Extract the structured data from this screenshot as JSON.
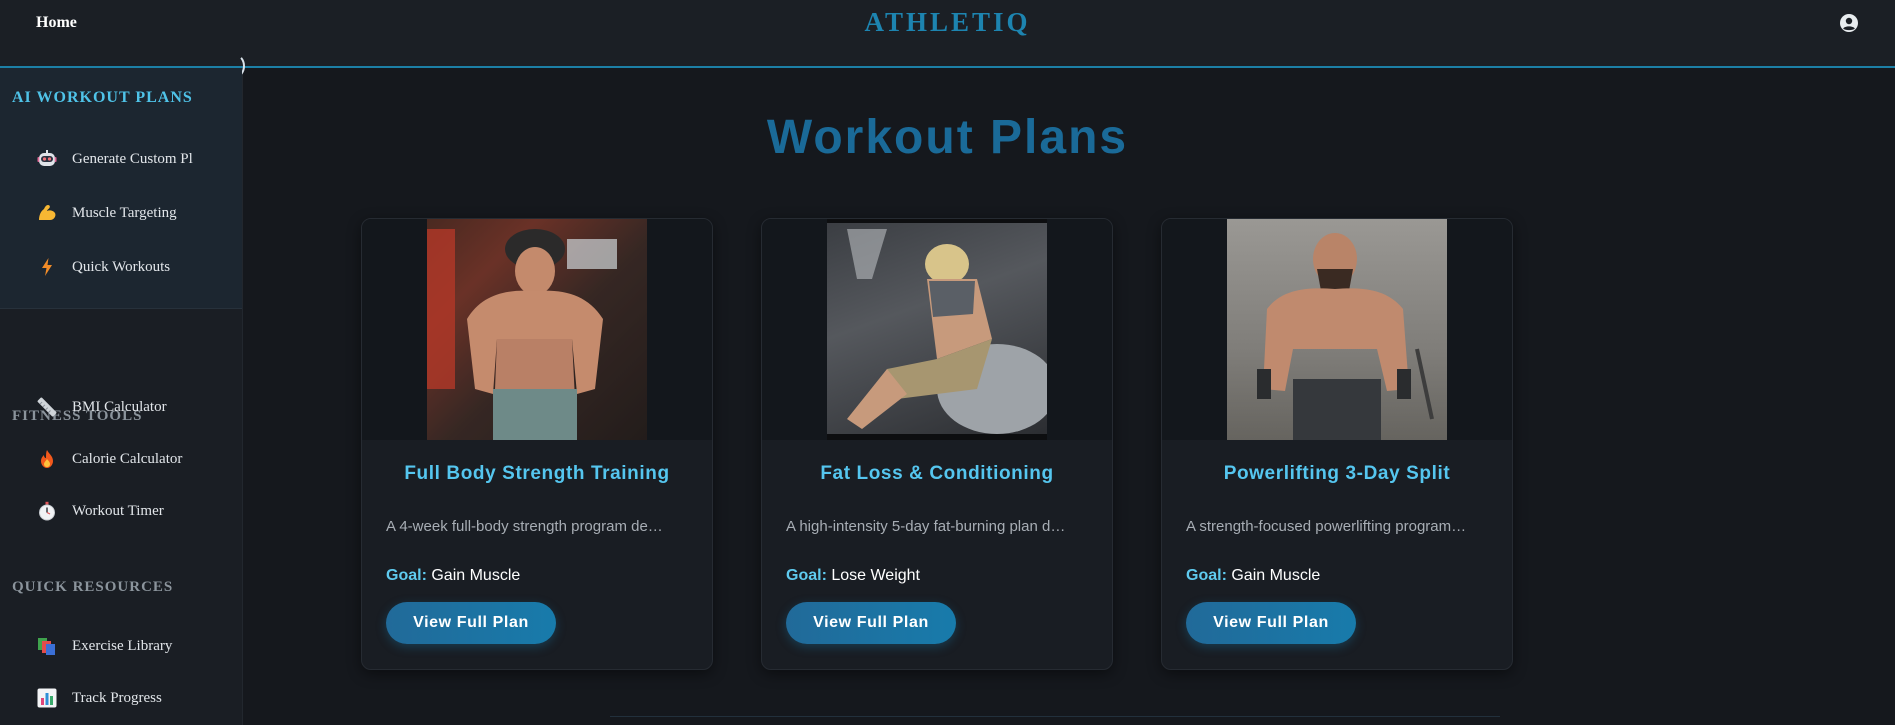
{
  "topbar": {
    "home_label": "Home",
    "brand": "ATHLETIQ",
    "user_icon": "user-circle-icon"
  },
  "sidebar": {
    "sections": [
      {
        "heading": "AI WORKOUT PLANS",
        "items": [
          {
            "label": "Generate Custom Pl",
            "icon": "robot-icon"
          },
          {
            "label": "Muscle Targeting",
            "icon": "flexed-bicep-icon"
          },
          {
            "label": "Quick Workouts",
            "icon": "lightning-icon"
          }
        ]
      },
      {
        "heading": "FITNESS TOOLS",
        "items": [
          {
            "label": "BMI Calculator",
            "icon": "ruler-icon"
          },
          {
            "label": "Calorie Calculator",
            "icon": "fire-icon"
          },
          {
            "label": "Workout Timer",
            "icon": "stopwatch-icon"
          }
        ]
      },
      {
        "heading": "QUICK RESOURCES",
        "items": [
          {
            "label": "Exercise Library",
            "icon": "books-icon"
          },
          {
            "label": "Track Progress",
            "icon": "bar-chart-icon"
          }
        ]
      }
    ]
  },
  "main": {
    "title": "Workout Plans",
    "goal_label": "Goal:",
    "cards": [
      {
        "title": "Full Body Strength Training",
        "description": "A 4-week full-body strength program de…",
        "goal": "Gain Muscle",
        "button": "View Full Plan"
      },
      {
        "title": "Fat Loss & Conditioning",
        "description": "A high-intensity 5-day fat-burning plan d…",
        "goal": "Lose Weight",
        "button": "View Full Plan"
      },
      {
        "title": "Powerlifting 3-Day Split",
        "description": "A strength-focused powerlifting program…",
        "goal": "Gain Muscle",
        "button": "View Full Plan"
      }
    ]
  },
  "colors": {
    "accent": "#1d84b0",
    "card_title": "#55c6ef",
    "background": "#15181d"
  }
}
